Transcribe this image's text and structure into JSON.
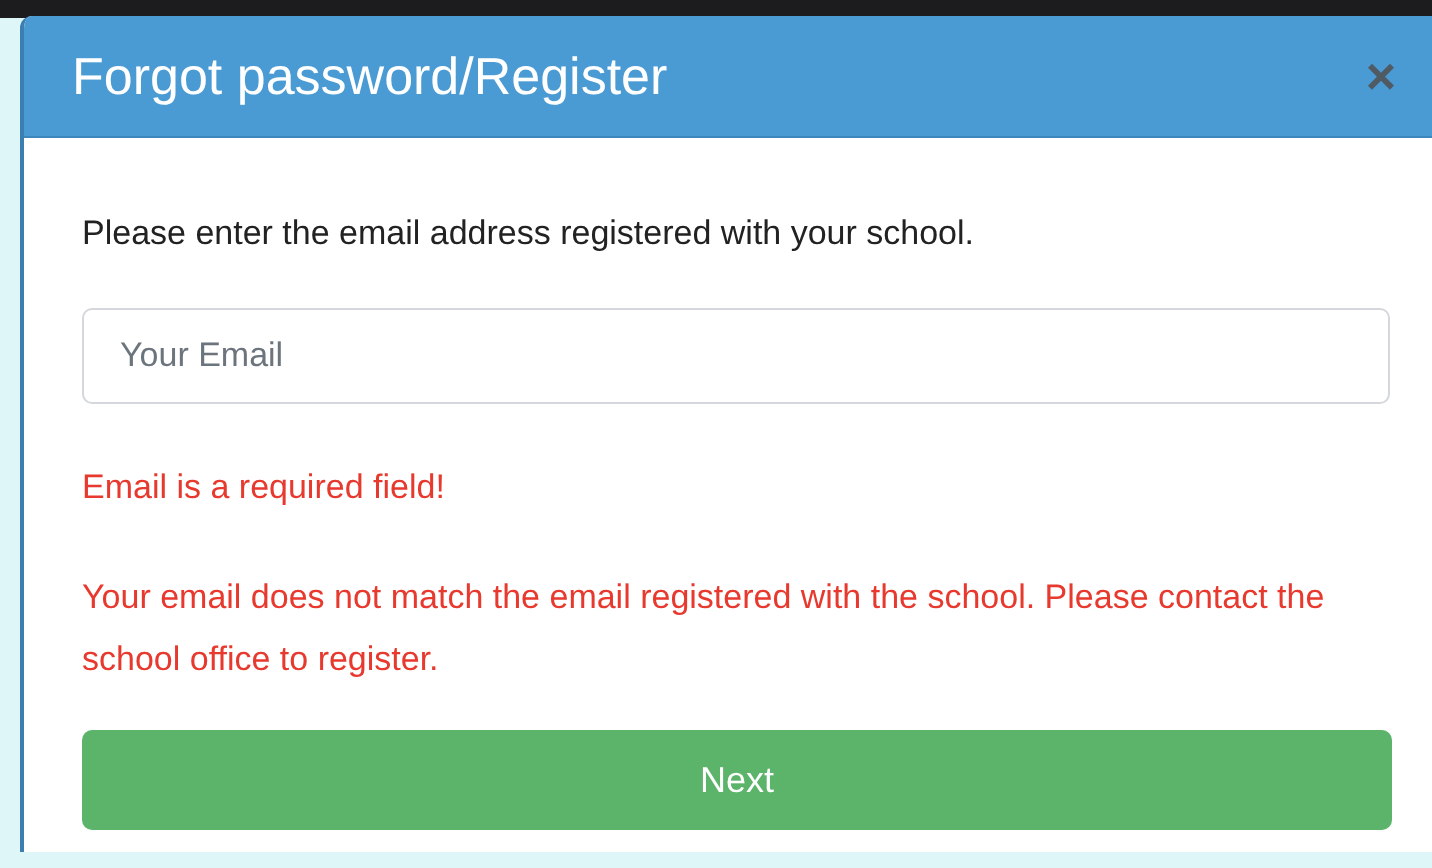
{
  "dialog": {
    "title": "Forgot password/Register",
    "close": "×"
  },
  "instructions": "Please enter the email address registered with your school.",
  "email_field": {
    "placeholder": "Your Email"
  },
  "errors": [
    "Email is a required field!",
    "Your email does not match the email registered with the school. Please contact the school office to register."
  ],
  "submit_button": "Next"
}
